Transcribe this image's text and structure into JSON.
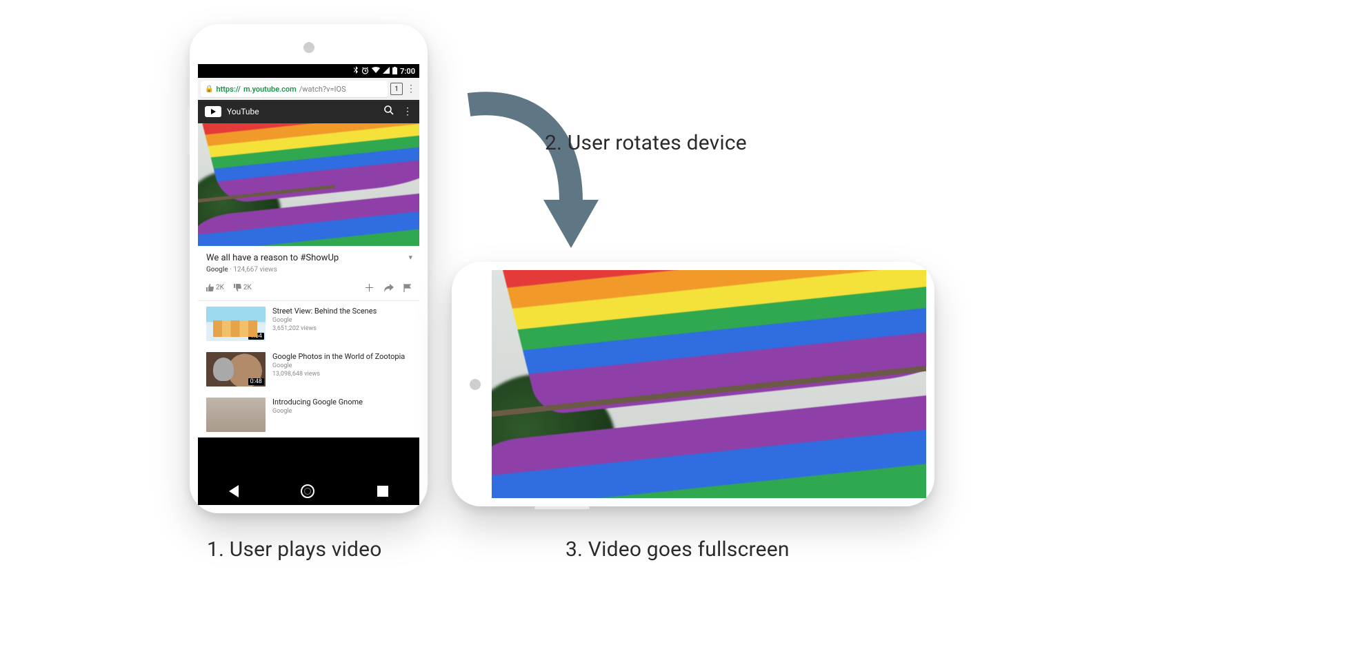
{
  "captions": {
    "step1": "1. User plays video",
    "step2": "2. User rotates device",
    "step3": "3. Video goes fullscreen"
  },
  "status_bar": {
    "time": "7:00",
    "icons": {
      "bluetooth": "bluetooth-icon",
      "alarm": "alarm-icon",
      "wifi": "wifi-icon",
      "cell": "cell-signal-icon",
      "battery": "battery-icon"
    }
  },
  "browser": {
    "url_protocol": "https://",
    "url_domain": "m.youtube.com",
    "url_path": "/watch?v=IOS",
    "tab_count": "1"
  },
  "youtube": {
    "brand": "YouTube",
    "video": {
      "title": "We all have a reason to #ShowUp",
      "channel": "Google",
      "views": "124,667 views",
      "likes": "2K",
      "dislikes": "2K"
    },
    "suggested": [
      {
        "title": "Street View: Behind the Scenes",
        "channel": "Google",
        "views": "3,651,202 views",
        "duration": "1:54"
      },
      {
        "title": "Google Photos in the World of Zootopia",
        "channel": "Google",
        "views": "13,098,648 views",
        "duration": "0:48"
      },
      {
        "title": "Introducing Google Gnome",
        "channel": "Google",
        "views": "",
        "duration": ""
      }
    ]
  }
}
